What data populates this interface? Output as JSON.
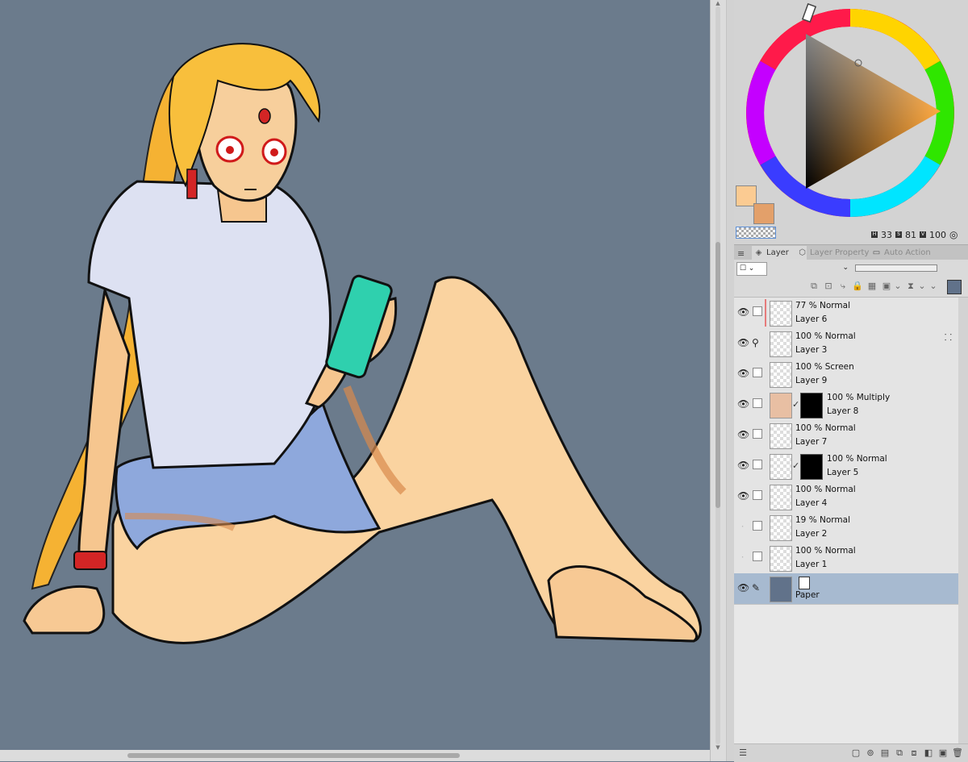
{
  "app": {
    "accent_color": "#5b8ed6",
    "canvas_bg": "#6b7b8c"
  },
  "color_panel": {
    "hue_value": "33",
    "saturation_value": "81",
    "value_value": "100",
    "main_color": "#fbcb92",
    "sub_color": "#e3a06a"
  },
  "tabs": [
    {
      "label": "Layer",
      "icon": "layers-icon"
    },
    {
      "label": "Layer Property",
      "icon": "layer-property-icon"
    },
    {
      "label": "Auto Action",
      "icon": "auto-action-icon"
    }
  ],
  "layers": [
    {
      "opacity_mode": "77 % Normal",
      "name": "Layer 6"
    },
    {
      "opacity_mode": "100 % Normal",
      "name": "Layer 3"
    },
    {
      "opacity_mode": "100 % Screen",
      "name": "Layer 9"
    },
    {
      "opacity_mode": "100 % Multiply",
      "name": "Layer 8"
    },
    {
      "opacity_mode": "100 % Normal",
      "name": "Layer 7"
    },
    {
      "opacity_mode": "100 % Normal",
      "name": "Layer 5"
    },
    {
      "opacity_mode": "100 % Normal",
      "name": "Layer 4"
    },
    {
      "opacity_mode": "19 % Normal",
      "name": "Layer 2"
    },
    {
      "opacity_mode": "100 % Normal",
      "name": "Layer 1"
    },
    {
      "opacity_mode": "",
      "name": "Paper"
    }
  ]
}
